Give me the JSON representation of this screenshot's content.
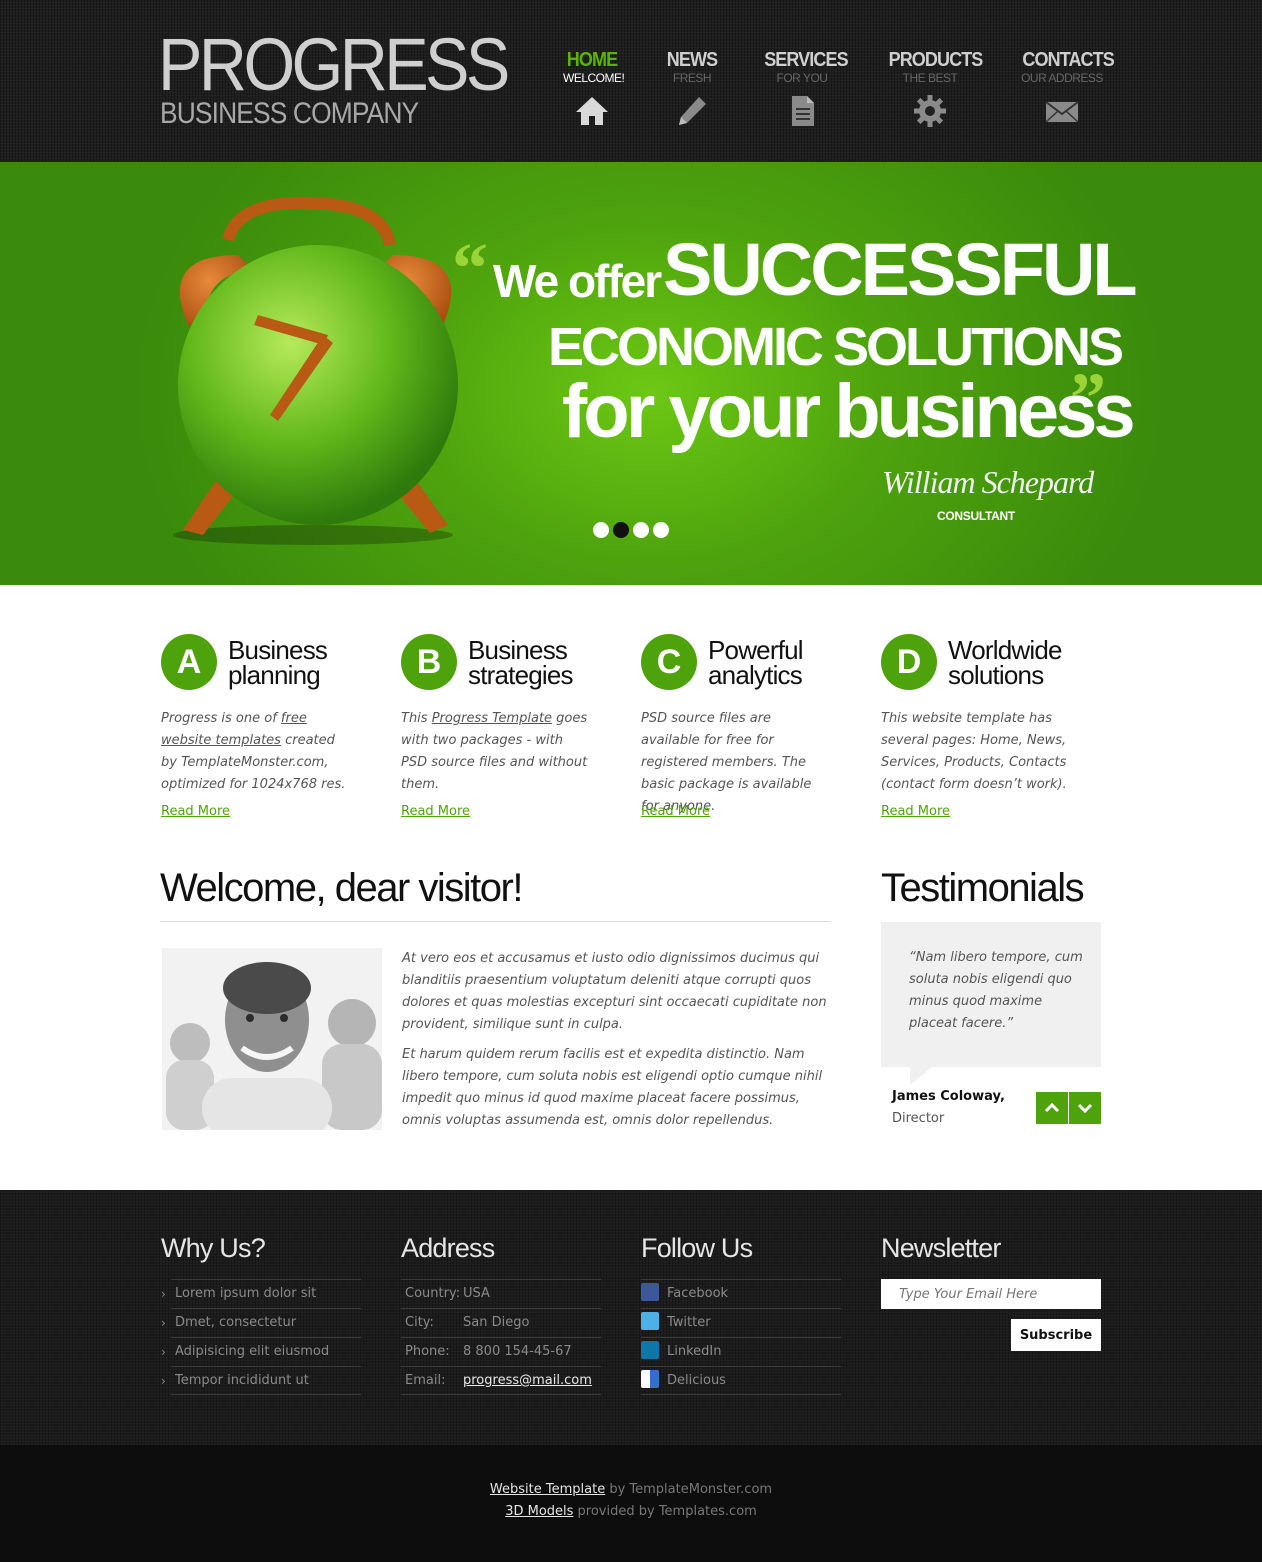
{
  "header": {
    "logo_title": "PROGRESS",
    "logo_sub": "BUSINESS COMPANY",
    "nav": [
      {
        "label": "HOME",
        "sub": "WELCOME!",
        "icon": "home-icon",
        "active": true
      },
      {
        "label": "NEWS",
        "sub": "FRESH",
        "icon": "pencil-icon",
        "active": false
      },
      {
        "label": "SERVICES",
        "sub": "FOR YOU",
        "icon": "document-icon",
        "active": false
      },
      {
        "label": "PRODUCTS",
        "sub": "THE BEST",
        "icon": "gear-icon",
        "active": false
      },
      {
        "label": "CONTACTS",
        "sub": "OUR ADDRESS",
        "icon": "mail-icon",
        "active": false
      }
    ]
  },
  "banner": {
    "quote_open": "“",
    "line1_small": "We offer",
    "line1_big": "SUCCESSFUL",
    "line2": "ECONOMIC SOLUTIONS",
    "line3": "for your business",
    "quote_close": "”",
    "signature": "William Schepard",
    "role": "CONSULTANT",
    "slides": 4,
    "active_slide": 2
  },
  "features": [
    {
      "letter": "A",
      "title1": "Business",
      "title2": "planning",
      "text_before": "Progress is one of ",
      "link": "free website templates",
      "text_after": " created by TemplateMonster.com, optimized for 1024x768 res.",
      "more": "Read More"
    },
    {
      "letter": "B",
      "title1": "Business",
      "title2": "strategies",
      "text_before": "This ",
      "link": "Progress Template",
      "text_after": " goes with two packages - with PSD source files and without them.",
      "more": "Read More"
    },
    {
      "letter": "C",
      "title1": "Powerful",
      "title2": "analytics",
      "text_before": "PSD source files are available for free for registered members. The basic package is available for anyone.",
      "link": "",
      "text_after": "",
      "more": "Read More"
    },
    {
      "letter": "D",
      "title1": "Worldwide",
      "title2": "solutions",
      "text_before": "This website template has several pages: Home, News, Services, Products, Contacts (contact form doesn’t work).",
      "link": "",
      "text_after": "",
      "more": "Read More"
    }
  ],
  "welcome": {
    "title": "Welcome, dear visitor!",
    "p1": "At vero eos et accusamus et iusto odio dignissimos ducimus qui blanditiis praesentium voluptatum deleniti atque corrupti quos dolores et quas molestias excepturi sint occaecati cupiditate non provident, similique sunt in culpa.",
    "p2": "Et harum quidem rerum facilis est et expedita distinctio. Nam libero tempore, cum soluta nobis est eligendi optio cumque nihil impedit quo minus id quod maxime placeat facere possimus, omnis voluptas assumenda est, omnis dolor repellendus."
  },
  "testimonials": {
    "title": "Testimonials",
    "quote": "“Nam libero tempore, cum soluta nobis eligendi quo minus quod maxime placeat facere.”",
    "name": "James Coloway,",
    "role": "Director"
  },
  "footer": {
    "why": {
      "title": "Why Us?",
      "items": [
        "Lorem ipsum dolor sit",
        "Dmet, consectetur",
        "Adipisicing elit eiusmod",
        "Tempor incididunt ut"
      ]
    },
    "address": {
      "title": "Address",
      "rows": [
        {
          "label": "Country:",
          "value": "USA"
        },
        {
          "label": "City:",
          "value": "San Diego"
        },
        {
          "label": "Phone:",
          "value": "8 800 154-45-67"
        },
        {
          "label": "Email:",
          "value": "progress@mail.com"
        }
      ]
    },
    "follow": {
      "title": "Follow Us",
      "items": [
        {
          "label": "Facebook",
          "icon": "facebook-icon",
          "color": "#3b5998"
        },
        {
          "label": "Twitter",
          "icon": "twitter-icon",
          "color": "#4fb0e6"
        },
        {
          "label": "LinkedIn",
          "icon": "linkedin-icon",
          "color": "#0e76a8"
        },
        {
          "label": "Delicious",
          "icon": "delicious-icon",
          "color": "#3271cb"
        }
      ]
    },
    "newsletter": {
      "title": "Newsletter",
      "placeholder": "Type Your Email Here",
      "button": "Subscribe"
    }
  },
  "copyright": {
    "link1": "Website Template",
    "text1": " by TemplateMonster.com",
    "link2": "3D Models",
    "text2": " provided by Templates.com"
  },
  "colors": {
    "accent": "#4ea30d",
    "nav_active": "#5bb300"
  }
}
